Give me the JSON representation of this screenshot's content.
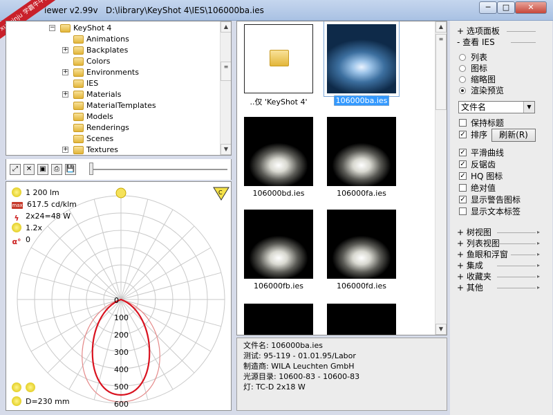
{
  "window": {
    "title": "iewer v2.99v   D:\\library\\KeyShot 4\\IES\\106000ba.ies",
    "badge": "xuexinju 学霸牛中文网",
    "min_label": "─",
    "max_label": "□",
    "close_label": "✕"
  },
  "tree": {
    "items": [
      {
        "label": "KeyShot 4",
        "expander": "−"
      },
      {
        "label": "Animations",
        "expander": ""
      },
      {
        "label": "Backplates",
        "expander": "+"
      },
      {
        "label": "Colors",
        "expander": ""
      },
      {
        "label": "Environments",
        "expander": "+"
      },
      {
        "label": "IES",
        "expander": ""
      },
      {
        "label": "Materials",
        "expander": "+"
      },
      {
        "label": "MaterialTemplates",
        "expander": ""
      },
      {
        "label": "Models",
        "expander": ""
      },
      {
        "label": "Renderings",
        "expander": ""
      },
      {
        "label": "Scenes",
        "expander": ""
      },
      {
        "label": "Textures",
        "expander": "+"
      }
    ]
  },
  "toolbar": {
    "buttons": [
      "⤢",
      "✕",
      "▣",
      "⎙",
      "💾"
    ]
  },
  "polar": {
    "lumen": "1 200 lm",
    "max_intensity": "617.5 cd/klm",
    "max_badge": "max",
    "power": "2x24=48 W",
    "factor": "1.2x",
    "alpha": "0",
    "alpha_symbol": "α°",
    "bolt_symbol": "ϟ",
    "diameter": "D=230 mm",
    "scale": [
      "0",
      "100",
      "200",
      "300",
      "400",
      "500",
      "600"
    ],
    "c_label": "C"
  },
  "thumbs": {
    "items": [
      {
        "caption": "..仅 'KeyShot 4'",
        "kind": "folder",
        "selected": false
      },
      {
        "caption": "106000ba.ies",
        "kind": "blue",
        "selected": true
      },
      {
        "caption": "106000bd.ies",
        "kind": "light",
        "selected": false
      },
      {
        "caption": "106000fa.ies",
        "kind": "light",
        "selected": false
      },
      {
        "caption": "106000fb.ies",
        "kind": "light",
        "selected": false
      },
      {
        "caption": "106000fd.ies",
        "kind": "light",
        "selected": false
      }
    ]
  },
  "fileinfo": {
    "lines": [
      "文件名: 106000ba.ies",
      "测试: 95-119 - 01.01.95/Labor",
      "制造商: WILA Leuchten GmbH",
      "光源目录: 10600-83 - 10600-83",
      "灯: TC-D 2x18 W"
    ]
  },
  "side": {
    "options_panel": "+ 选项面板",
    "view_ies": "- 查看 IES",
    "view_modes": [
      {
        "label": "列表",
        "on": false
      },
      {
        "label": "图标",
        "on": false
      },
      {
        "label": "缩略图",
        "on": false
      },
      {
        "label": "渲染预览",
        "on": true
      }
    ],
    "sort_select": "文件名",
    "checks_a": [
      {
        "label": "保持标题",
        "on": false
      },
      {
        "label": "排序",
        "on": true
      }
    ],
    "refresh_label": "刷新(R)",
    "checks_b": [
      {
        "label": "平滑曲线",
        "on": true
      },
      {
        "label": "反锯齿",
        "on": true
      },
      {
        "label": "HQ 图标",
        "on": true
      },
      {
        "label": "绝对值",
        "on": false
      },
      {
        "label": "显示警告图标",
        "on": true
      },
      {
        "label": "显示文本标签",
        "on": false
      }
    ],
    "groups": [
      "+ 树视图",
      "+ 列表视图",
      "+ 鱼眼和浮窗",
      "+ 集成",
      "+ 收藏夹",
      "+ 其他"
    ]
  },
  "colors": {
    "selection": "#3399ff",
    "curve_main": "#d9121f",
    "curve_secondary": "#e58a8a",
    "grid": "#c9c9c9"
  }
}
